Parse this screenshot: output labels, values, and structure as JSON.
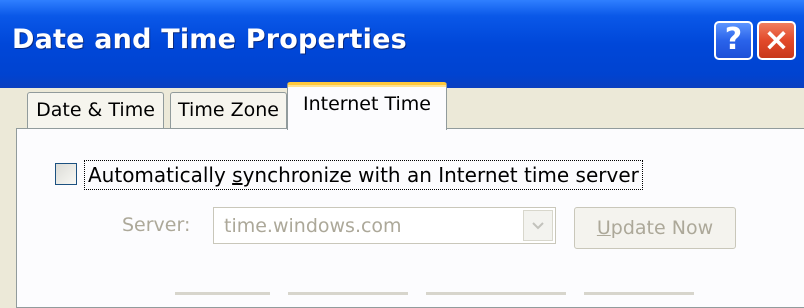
{
  "window": {
    "title": "Date and Time Properties",
    "help_label": "?",
    "close_label": "×"
  },
  "tabs": [
    {
      "label": "Date & Time",
      "active": false
    },
    {
      "label": "Time Zone",
      "active": false
    },
    {
      "label": "Internet Time",
      "active": true
    }
  ],
  "sync": {
    "checked": false,
    "label_before": "Automatically ",
    "label_underlined": "s",
    "label_after": "ynchronize with an Internet time server"
  },
  "server": {
    "label": "Server:",
    "value": "time.windows.com",
    "enabled": false
  },
  "update_button": {
    "label_underlined": "U",
    "label_rest": "pdate Now",
    "enabled": false
  },
  "colors": {
    "titlebar": "#0047d9",
    "active_tab_accent": "#ffc83c",
    "disabled_text": "#aca899",
    "window_bg": "#ece9d8"
  }
}
